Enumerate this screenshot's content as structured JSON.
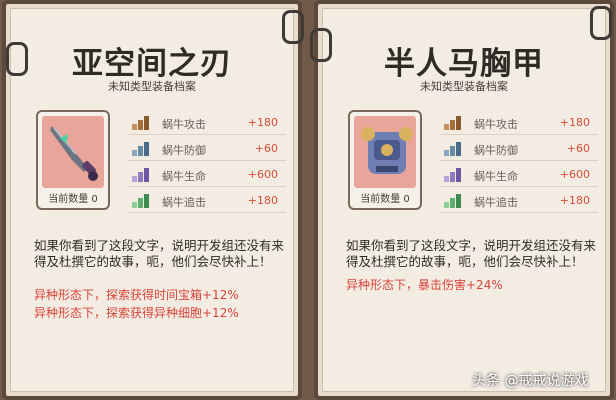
{
  "cards": [
    {
      "title": "亚空间之刃",
      "subtitle": "未知类型装备档案",
      "count_label": "当前数量",
      "count_value": "0",
      "stats": [
        {
          "label": "蜗牛攻击",
          "value": "+180",
          "icon": "attack-icon"
        },
        {
          "label": "蜗牛防御",
          "value": "+60",
          "icon": "defense-icon"
        },
        {
          "label": "蜗牛生命",
          "value": "+600",
          "icon": "life-icon"
        },
        {
          "label": "蜗牛追击",
          "value": "+180",
          "icon": "pursuit-icon"
        }
      ],
      "description": "如果你看到了这段文字，说明开发组还没有来得及杜撰它的故事，呃，他们会尽快补上！",
      "bonuses": [
        "异种形态下，探索获得时间宝箱+12%",
        "异种形态下，探索获得异种细胞+12%"
      ],
      "item_icon": "blade-icon",
      "item_color": "#e9a59a"
    },
    {
      "title": "半人马胸甲",
      "subtitle": "未知类型装备档案",
      "count_label": "当前数量",
      "count_value": "0",
      "stats": [
        {
          "label": "蜗牛攻击",
          "value": "+180",
          "icon": "attack-icon"
        },
        {
          "label": "蜗牛防御",
          "value": "+60",
          "icon": "defense-icon"
        },
        {
          "label": "蜗牛生命",
          "value": "+600",
          "icon": "life-icon"
        },
        {
          "label": "蜗牛追击",
          "value": "+180",
          "icon": "pursuit-icon"
        }
      ],
      "description": "如果你看到了这段文字，说明开发组还没有来得及杜撰它的故事，呃，他们会尽快补上！",
      "bonuses": [
        "异种形态下，暴击伤害+24%"
      ],
      "item_icon": "chest-armor-icon",
      "item_color": "#e9a59a"
    }
  ],
  "watermark": "头条 @戒戒说游戏"
}
